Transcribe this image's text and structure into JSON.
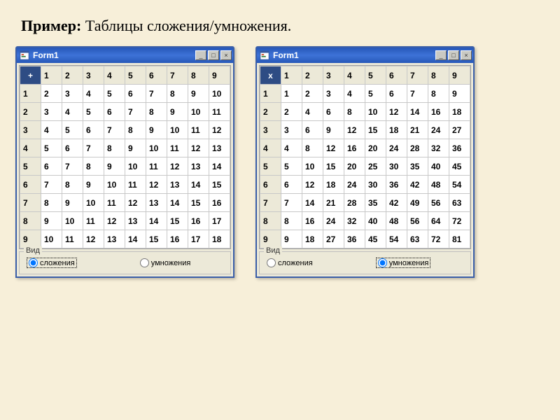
{
  "heading": {
    "bold": "Пример:",
    "rest": "Таблицы сложения/умножения."
  },
  "windows": [
    {
      "title": "Form1",
      "corner": "+",
      "groupbox_label": "Вид",
      "radio_add": "сложения",
      "radio_mul": "умножения",
      "selected": "add",
      "header": [
        "1",
        "2",
        "3",
        "4",
        "5",
        "6",
        "7",
        "8",
        "9"
      ],
      "rows": [
        {
          "label": "1",
          "cells": [
            "2",
            "3",
            "4",
            "5",
            "6",
            "7",
            "8",
            "9",
            "10"
          ]
        },
        {
          "label": "2",
          "cells": [
            "3",
            "4",
            "5",
            "6",
            "7",
            "8",
            "9",
            "10",
            "11"
          ]
        },
        {
          "label": "3",
          "cells": [
            "4",
            "5",
            "6",
            "7",
            "8",
            "9",
            "10",
            "11",
            "12"
          ]
        },
        {
          "label": "4",
          "cells": [
            "5",
            "6",
            "7",
            "8",
            "9",
            "10",
            "11",
            "12",
            "13"
          ]
        },
        {
          "label": "5",
          "cells": [
            "6",
            "7",
            "8",
            "9",
            "10",
            "11",
            "12",
            "13",
            "14"
          ]
        },
        {
          "label": "6",
          "cells": [
            "7",
            "8",
            "9",
            "10",
            "11",
            "12",
            "13",
            "14",
            "15"
          ]
        },
        {
          "label": "7",
          "cells": [
            "8",
            "9",
            "10",
            "11",
            "12",
            "13",
            "14",
            "15",
            "16"
          ]
        },
        {
          "label": "8",
          "cells": [
            "9",
            "10",
            "11",
            "12",
            "13",
            "14",
            "15",
            "16",
            "17"
          ]
        },
        {
          "label": "9",
          "cells": [
            "10",
            "11",
            "12",
            "13",
            "14",
            "15",
            "16",
            "17",
            "18"
          ]
        }
      ]
    },
    {
      "title": "Form1",
      "corner": "x",
      "groupbox_label": "Вид",
      "radio_add": "сложения",
      "radio_mul": "умножения",
      "selected": "mul",
      "header": [
        "1",
        "2",
        "3",
        "4",
        "5",
        "6",
        "7",
        "8",
        "9"
      ],
      "rows": [
        {
          "label": "1",
          "cells": [
            "1",
            "2",
            "3",
            "4",
            "5",
            "6",
            "7",
            "8",
            "9"
          ]
        },
        {
          "label": "2",
          "cells": [
            "2",
            "4",
            "6",
            "8",
            "10",
            "12",
            "14",
            "16",
            "18"
          ]
        },
        {
          "label": "3",
          "cells": [
            "3",
            "6",
            "9",
            "12",
            "15",
            "18",
            "21",
            "24",
            "27"
          ]
        },
        {
          "label": "4",
          "cells": [
            "4",
            "8",
            "12",
            "16",
            "20",
            "24",
            "28",
            "32",
            "36"
          ]
        },
        {
          "label": "5",
          "cells": [
            "5",
            "10",
            "15",
            "20",
            "25",
            "30",
            "35",
            "40",
            "45"
          ]
        },
        {
          "label": "6",
          "cells": [
            "6",
            "12",
            "18",
            "24",
            "30",
            "36",
            "42",
            "48",
            "54"
          ]
        },
        {
          "label": "7",
          "cells": [
            "7",
            "14",
            "21",
            "28",
            "35",
            "42",
            "49",
            "56",
            "63"
          ]
        },
        {
          "label": "8",
          "cells": [
            "8",
            "16",
            "24",
            "32",
            "40",
            "48",
            "56",
            "64",
            "72"
          ]
        },
        {
          "label": "9",
          "cells": [
            "9",
            "18",
            "27",
            "36",
            "45",
            "54",
            "63",
            "72",
            "81"
          ]
        }
      ]
    }
  ],
  "winbtns": {
    "min": "_",
    "max": "□",
    "close": "×"
  }
}
